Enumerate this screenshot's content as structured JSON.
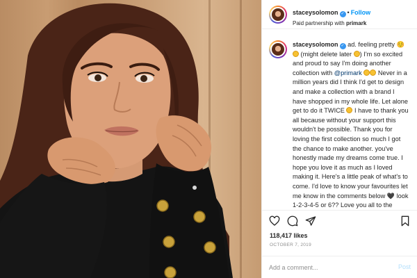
{
  "post": {
    "username": "staceysolomon",
    "follow_label": "Follow",
    "dot": "•",
    "partnership_prefix": "Paid partnership with ",
    "partner": "primark"
  },
  "caption": {
    "username": "staceysolomon",
    "t1": " ad. feeling pretty ☺️ ",
    "t2": " (might delete later ",
    "t3": ") I'm so excited and proud to say I'm doing another collection with ",
    "mention": "@primark",
    "t4": " Never in a million years did I think I'd get to design and make a collection with a brand I have shopped in my whole life. Let alone get to do it TWICE ",
    "t5": " I have to thank you all because without your support this wouldn't be possible. Thank you for loving the first collection so much I got the chance to make another. you've honestly made my dreams come true. I hope you love it as much as I loved making it. Here's a little peak of what's to come. I'd love to know your favourites let me know in the comments below ",
    "heart": "🖤",
    "t6": " look 1-2-3-4-5 or 6?? Love you all to the moon & back"
  },
  "likes": "118,417 likes",
  "date": "OCTOBER 7, 2019",
  "comment": {
    "placeholder": "Add a comment...",
    "post_label": "Post"
  },
  "icons": {
    "verified": "verified-badge-icon",
    "like": "heart-icon",
    "comment": "comment-bubble-icon",
    "share": "paper-plane-icon",
    "save": "bookmark-icon"
  },
  "colors": {
    "link_blue": "#0095f6",
    "verified_blue": "#3897f0",
    "mention": "#00376b",
    "muted": "#8e8e8e",
    "post_disabled": "#b2dffc",
    "sweater": "#141414",
    "buttons": "#c9a23b"
  }
}
